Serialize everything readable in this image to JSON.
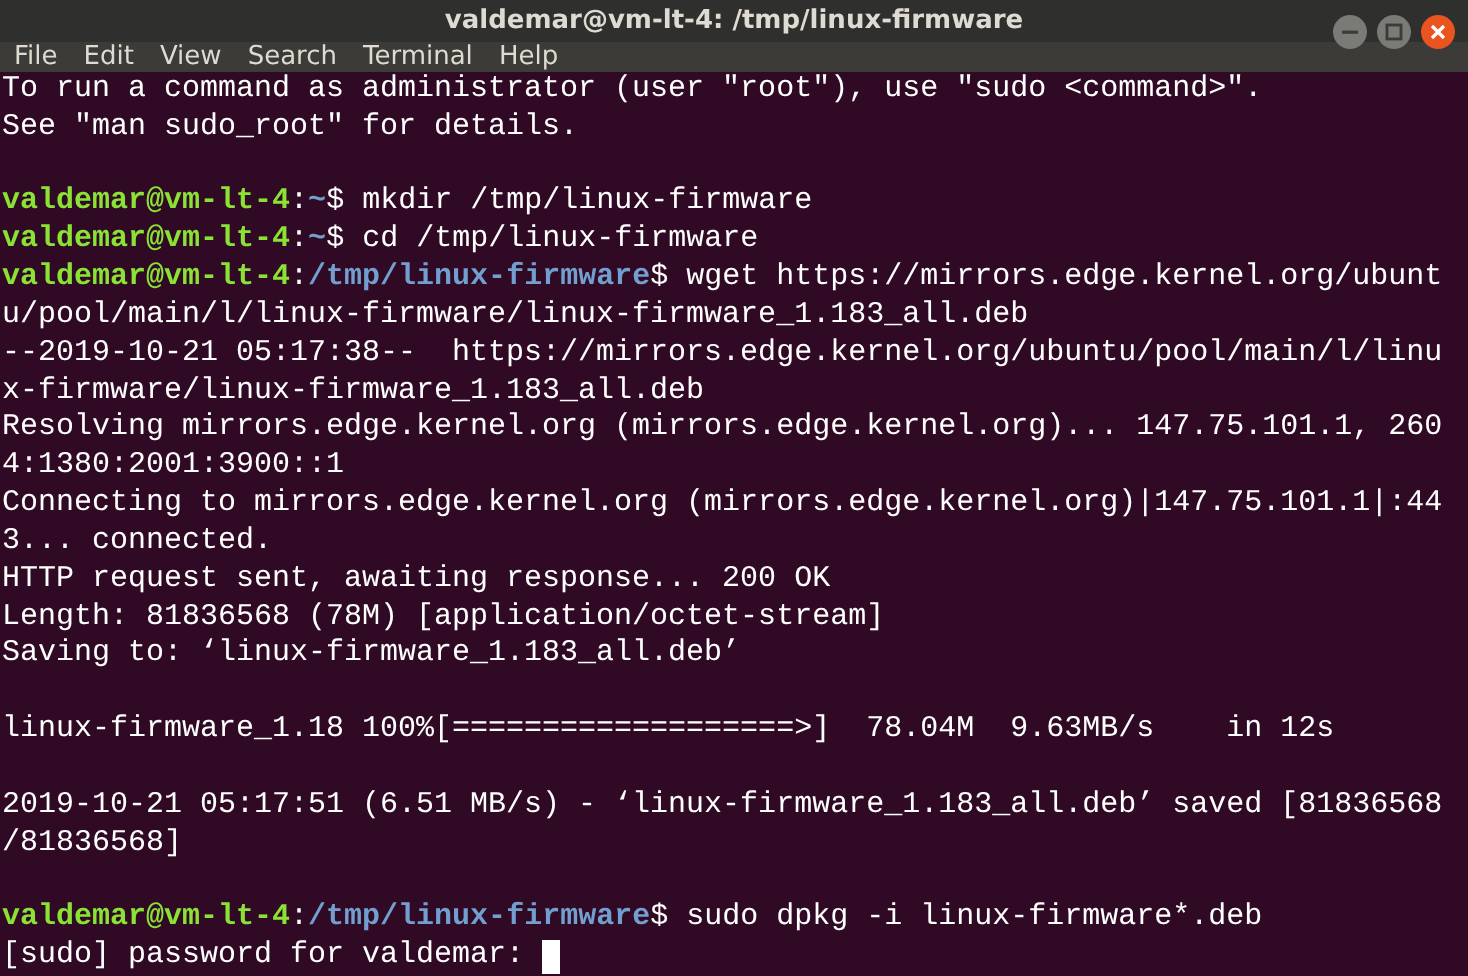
{
  "window": {
    "title": "valdemar@vm-lt-4: /tmp/linux-firmware"
  },
  "menu": [
    "File",
    "Edit",
    "View",
    "Search",
    "Terminal",
    "Help"
  ],
  "terminal": {
    "cursor_visible": true,
    "lines": [
      {
        "kind": "output",
        "text": "To run a command as administrator (user \"root\"), use \"sudo <command>\"."
      },
      {
        "kind": "output",
        "text": "See \"man sudo_root\" for details."
      },
      {
        "kind": "blank"
      },
      {
        "kind": "prompt",
        "user": "valdemar@vm-lt-4",
        "sep": ":",
        "path": "~",
        "symbol": "$",
        "command": "mkdir /tmp/linux-firmware"
      },
      {
        "kind": "prompt",
        "user": "valdemar@vm-lt-4",
        "sep": ":",
        "path": "~",
        "symbol": "$",
        "command": "cd /tmp/linux-firmware"
      },
      {
        "kind": "prompt",
        "user": "valdemar@vm-lt-4",
        "sep": ":",
        "path": "/tmp/linux-firmware",
        "symbol": "$",
        "command": "wget https://mirrors.edge.kernel.org/ubunt"
      },
      {
        "kind": "output",
        "text": "u/pool/main/l/linux-firmware/linux-firmware_1.183_all.deb"
      },
      {
        "kind": "output",
        "text": "--2019-10-21 05:17:38--  https://mirrors.edge.kernel.org/ubuntu/pool/main/l/linu"
      },
      {
        "kind": "output",
        "text": "x-firmware/linux-firmware_1.183_all.deb"
      },
      {
        "kind": "output",
        "text": "Resolving mirrors.edge.kernel.org (mirrors.edge.kernel.org)... 147.75.101.1, 260"
      },
      {
        "kind": "output",
        "text": "4:1380:2001:3900::1"
      },
      {
        "kind": "output",
        "text": "Connecting to mirrors.edge.kernel.org (mirrors.edge.kernel.org)|147.75.101.1|:44"
      },
      {
        "kind": "output",
        "text": "3... connected."
      },
      {
        "kind": "output",
        "text": "HTTP request sent, awaiting response... 200 OK"
      },
      {
        "kind": "output",
        "text": "Length: 81836568 (78M) [application/octet-stream]"
      },
      {
        "kind": "output",
        "text": "Saving to: ‘linux-firmware_1.183_all.deb’"
      },
      {
        "kind": "blank"
      },
      {
        "kind": "output",
        "text": "linux-firmware_1.18 100%[===================>]  78.04M  9.63MB/s    in 12s"
      },
      {
        "kind": "blank"
      },
      {
        "kind": "output",
        "text": "2019-10-21 05:17:51 (6.51 MB/s) - ‘linux-firmware_1.183_all.deb’ saved [81836568"
      },
      {
        "kind": "output",
        "text": "/81836568]"
      },
      {
        "kind": "blank"
      },
      {
        "kind": "prompt",
        "user": "valdemar@vm-lt-4",
        "sep": ":",
        "path": "/tmp/linux-firmware",
        "symbol": "$",
        "command": "sudo dpkg -i linux-firmware*.deb"
      },
      {
        "kind": "output",
        "text": "[sudo] password for valdemar:"
      }
    ]
  }
}
